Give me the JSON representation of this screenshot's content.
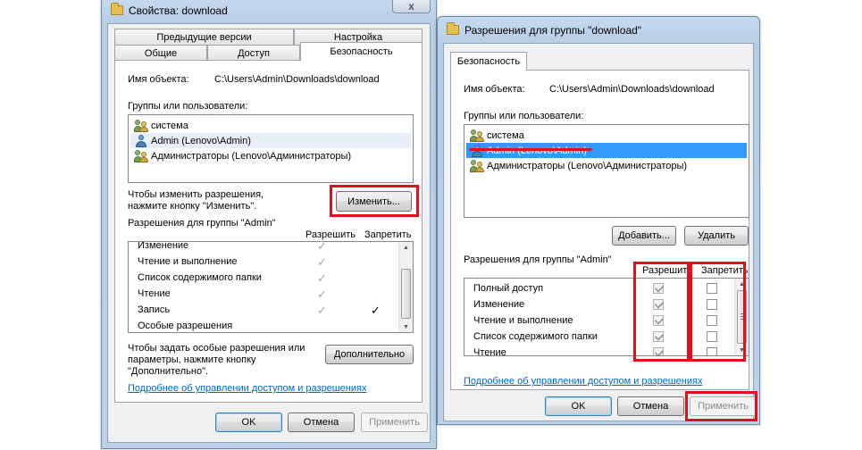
{
  "left_window": {
    "title": "Свойства: download",
    "tabs_back": [
      "Предыдущие версии",
      "Настройка"
    ],
    "tabs_front": [
      "Общие",
      "Доступ",
      "Безопасность"
    ],
    "object_label": "Имя объекта:",
    "object_path": "C:\\Users\\Admin\\Downloads\\download",
    "groups_label": "Группы или пользователи:",
    "users": [
      "система",
      "Admin (Lenovo\\Admin)",
      "Администраторы (Lenovo\\Администраторы)"
    ],
    "change_hint_1": "Чтобы изменить разрешения,",
    "change_hint_2": "нажмите кнопку \"Изменить\".",
    "change_button": "Изменить...",
    "perm_label": "Разрешения для группы \"Admin\"",
    "allow_header": "Разрешить",
    "deny_header": "Запретить",
    "permissions": [
      "Изменение",
      "Чтение и выполнение",
      "Список содержимого папки",
      "Чтение",
      "Запись",
      "Особые разрешения"
    ],
    "special_hint_1": "Чтобы задать особые разрешения или",
    "special_hint_2": "параметры, нажмите кнопку",
    "special_hint_3": "\"Дополнительно\".",
    "advanced_button": "Дополнительно",
    "learn_link": "Подробнее об управлении доступом и разрешениях",
    "ok": "OK",
    "cancel": "Отмена",
    "apply": "Применить",
    "close_glyph": "x"
  },
  "right_window": {
    "title": "Разрешения для группы \"download\"",
    "tab": "Безопасность",
    "object_label": "Имя объекта:",
    "object_path": "C:\\Users\\Admin\\Downloads\\download",
    "groups_label": "Группы или пользователи:",
    "users": [
      "система",
      "Admin (Lenovo\\Admin)",
      "Администраторы (Lenovo\\Администраторы)"
    ],
    "add_button": "Добавить...",
    "remove_button": "Удалить",
    "perm_label": "Разрешения для группы \"Admin\"",
    "allow_header": "Разрешить",
    "deny_header": "Запретить",
    "permissions": [
      "Полный доступ",
      "Изменение",
      "Чтение и выполнение",
      "Список содержимого папки",
      "Чтение"
    ],
    "learn_link": "Подробнее об управлении доступом и разрешениях",
    "ok": "OK",
    "cancel": "Отмена",
    "apply": "Применить"
  },
  "colors": {
    "highlight": "#e10f19",
    "selection": "#3399ff",
    "link": "#0066cc"
  }
}
